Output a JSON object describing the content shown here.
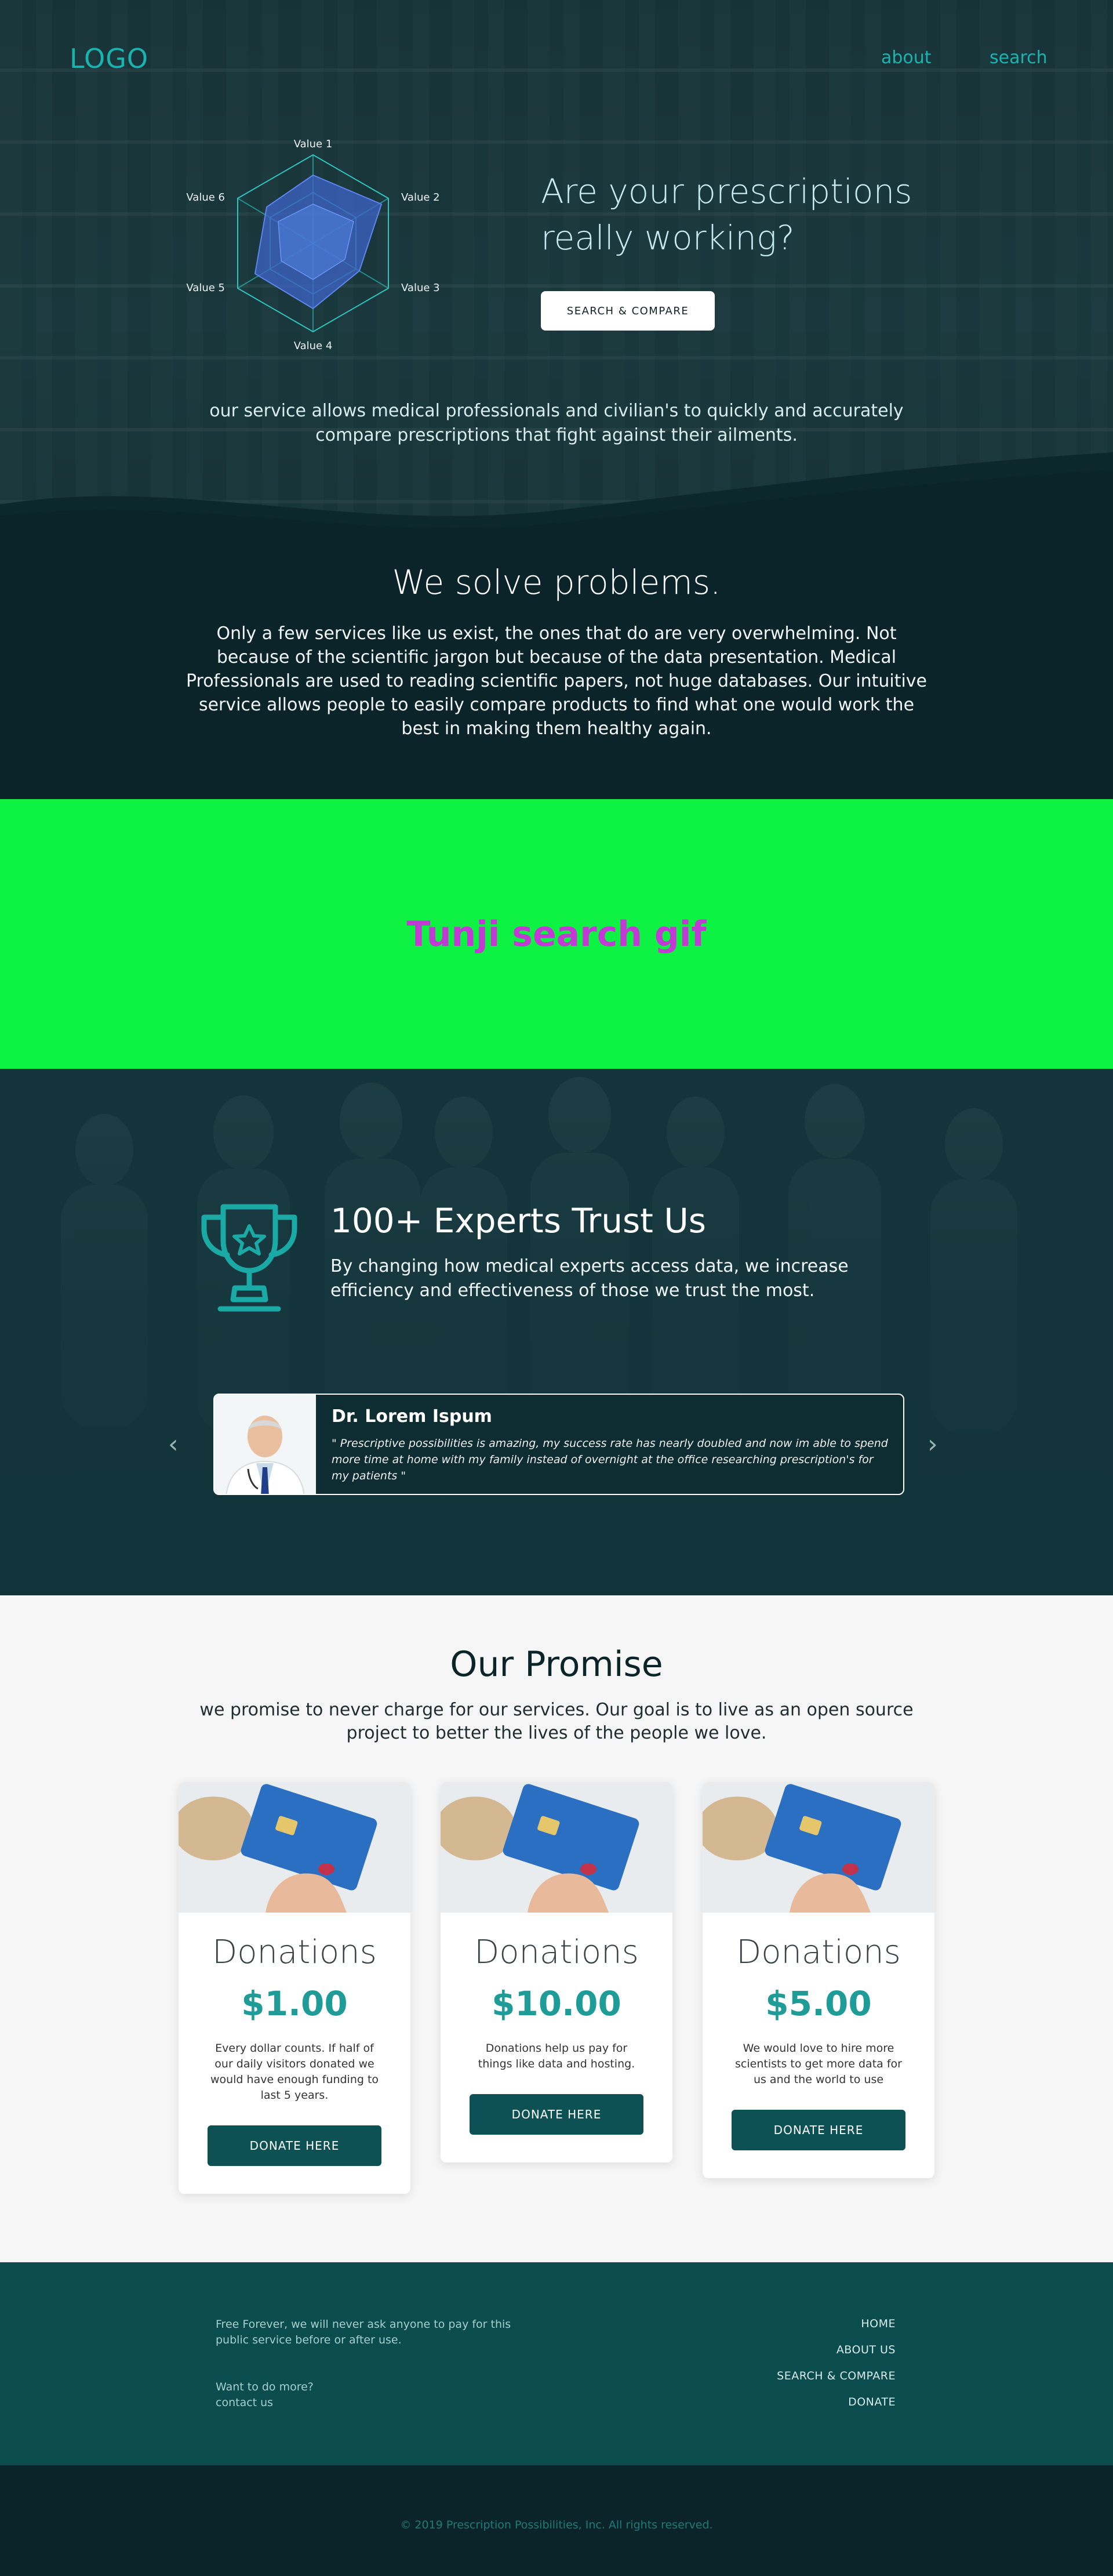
{
  "header": {
    "logo": "LOGO",
    "nav": [
      "about",
      "search"
    ]
  },
  "hero": {
    "radar_labels": [
      "Value 1",
      "Value 2",
      "Value 3",
      "Value 4",
      "Value 5",
      "Value 6"
    ],
    "title": "Are your prescriptions really working?",
    "button": "SEARCH & COMPARE",
    "description": "our service allows medical professionals and civilian's to quickly and accurately compare prescriptions that fight against their ailments."
  },
  "solve": {
    "title": "We solve problems.",
    "text": "Only a few services like us exist, the ones that do are very overwhelming. Not because of the scientific jargon but because of the data presentation. Medical Professionals are used to reading scientific papers, not huge databases. Our intuitive service allows people to easily compare products to find what one would work the best in making them healthy again."
  },
  "gif_placeholder": {
    "label": "Tunji search gif",
    "bg": "#0ef244",
    "color": "#c13ad3"
  },
  "experts": {
    "title": "100+ Experts Trust Us",
    "text": "By changing how medical experts access data, we increase efficiency and effectiveness of those we trust the most.",
    "testimonial": {
      "name": "Dr. Lorem Ispum",
      "quote": "\" Prescriptive possibilities is amazing, my success rate has nearly doubled and now im able to spend more time at home with my family instead of overnight at the office researching prescription's for my patients \""
    },
    "arrow_left": "‹",
    "arrow_right": "›"
  },
  "promise": {
    "title": "Our Promise",
    "text": "we promise to never charge for our services. Our goal is to live as an open source project to better the lives of the people we love.",
    "cards": [
      {
        "title": "Donations",
        "price": "$1.00",
        "description": "Every dollar counts. If half of our daily visitors donated we would have enough funding to last 5 years.",
        "button": "DONATE HERE"
      },
      {
        "title": "Donations",
        "price": "$10.00",
        "description": "Donations help us pay for things like data and hosting.",
        "button": "DONATE HERE"
      },
      {
        "title": "Donations",
        "price": "$5.00",
        "description": "We would love to hire more scientists to get more data for us and the world to use",
        "button": "DONATE HERE"
      }
    ]
  },
  "footer": {
    "free_text": "Free Forever, we will never ask anyone to pay for this public service before or after use.",
    "more_line1": "Want to do more?",
    "more_line2": "contact us",
    "links": [
      "HOME",
      "ABOUT US",
      "SEARCH & COMPARE",
      "DONATE"
    ],
    "copyright": "© 2019 Prescription Possibilities, Inc. All rights reserved."
  },
  "colors": {
    "accent": "#19b4b0",
    "dark": "#0b2429",
    "teal_button": "#0e5155",
    "footer_bg": "#0b4c4e",
    "promise_bg": "#f6f6f6"
  }
}
